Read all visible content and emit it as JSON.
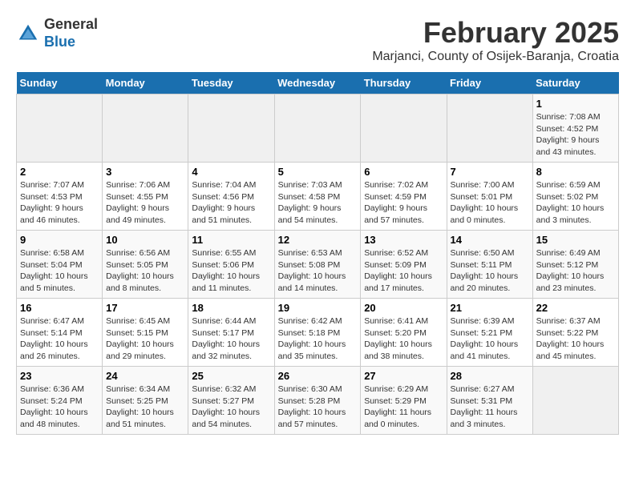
{
  "header": {
    "logo_general": "General",
    "logo_blue": "Blue",
    "month_title": "February 2025",
    "location": "Marjanci, County of Osijek-Baranja, Croatia"
  },
  "days_of_week": [
    "Sunday",
    "Monday",
    "Tuesday",
    "Wednesday",
    "Thursday",
    "Friday",
    "Saturday"
  ],
  "weeks": [
    [
      {
        "day": "",
        "info": ""
      },
      {
        "day": "",
        "info": ""
      },
      {
        "day": "",
        "info": ""
      },
      {
        "day": "",
        "info": ""
      },
      {
        "day": "",
        "info": ""
      },
      {
        "day": "",
        "info": ""
      },
      {
        "day": "1",
        "info": "Sunrise: 7:08 AM\nSunset: 4:52 PM\nDaylight: 9 hours\nand 43 minutes."
      }
    ],
    [
      {
        "day": "2",
        "info": "Sunrise: 7:07 AM\nSunset: 4:53 PM\nDaylight: 9 hours\nand 46 minutes."
      },
      {
        "day": "3",
        "info": "Sunrise: 7:06 AM\nSunset: 4:55 PM\nDaylight: 9 hours\nand 49 minutes."
      },
      {
        "day": "4",
        "info": "Sunrise: 7:04 AM\nSunset: 4:56 PM\nDaylight: 9 hours\nand 51 minutes."
      },
      {
        "day": "5",
        "info": "Sunrise: 7:03 AM\nSunset: 4:58 PM\nDaylight: 9 hours\nand 54 minutes."
      },
      {
        "day": "6",
        "info": "Sunrise: 7:02 AM\nSunset: 4:59 PM\nDaylight: 9 hours\nand 57 minutes."
      },
      {
        "day": "7",
        "info": "Sunrise: 7:00 AM\nSunset: 5:01 PM\nDaylight: 10 hours\nand 0 minutes."
      },
      {
        "day": "8",
        "info": "Sunrise: 6:59 AM\nSunset: 5:02 PM\nDaylight: 10 hours\nand 3 minutes."
      }
    ],
    [
      {
        "day": "9",
        "info": "Sunrise: 6:58 AM\nSunset: 5:04 PM\nDaylight: 10 hours\nand 5 minutes."
      },
      {
        "day": "10",
        "info": "Sunrise: 6:56 AM\nSunset: 5:05 PM\nDaylight: 10 hours\nand 8 minutes."
      },
      {
        "day": "11",
        "info": "Sunrise: 6:55 AM\nSunset: 5:06 PM\nDaylight: 10 hours\nand 11 minutes."
      },
      {
        "day": "12",
        "info": "Sunrise: 6:53 AM\nSunset: 5:08 PM\nDaylight: 10 hours\nand 14 minutes."
      },
      {
        "day": "13",
        "info": "Sunrise: 6:52 AM\nSunset: 5:09 PM\nDaylight: 10 hours\nand 17 minutes."
      },
      {
        "day": "14",
        "info": "Sunrise: 6:50 AM\nSunset: 5:11 PM\nDaylight: 10 hours\nand 20 minutes."
      },
      {
        "day": "15",
        "info": "Sunrise: 6:49 AM\nSunset: 5:12 PM\nDaylight: 10 hours\nand 23 minutes."
      }
    ],
    [
      {
        "day": "16",
        "info": "Sunrise: 6:47 AM\nSunset: 5:14 PM\nDaylight: 10 hours\nand 26 minutes."
      },
      {
        "day": "17",
        "info": "Sunrise: 6:45 AM\nSunset: 5:15 PM\nDaylight: 10 hours\nand 29 minutes."
      },
      {
        "day": "18",
        "info": "Sunrise: 6:44 AM\nSunset: 5:17 PM\nDaylight: 10 hours\nand 32 minutes."
      },
      {
        "day": "19",
        "info": "Sunrise: 6:42 AM\nSunset: 5:18 PM\nDaylight: 10 hours\nand 35 minutes."
      },
      {
        "day": "20",
        "info": "Sunrise: 6:41 AM\nSunset: 5:20 PM\nDaylight: 10 hours\nand 38 minutes."
      },
      {
        "day": "21",
        "info": "Sunrise: 6:39 AM\nSunset: 5:21 PM\nDaylight: 10 hours\nand 41 minutes."
      },
      {
        "day": "22",
        "info": "Sunrise: 6:37 AM\nSunset: 5:22 PM\nDaylight: 10 hours\nand 45 minutes."
      }
    ],
    [
      {
        "day": "23",
        "info": "Sunrise: 6:36 AM\nSunset: 5:24 PM\nDaylight: 10 hours\nand 48 minutes."
      },
      {
        "day": "24",
        "info": "Sunrise: 6:34 AM\nSunset: 5:25 PM\nDaylight: 10 hours\nand 51 minutes."
      },
      {
        "day": "25",
        "info": "Sunrise: 6:32 AM\nSunset: 5:27 PM\nDaylight: 10 hours\nand 54 minutes."
      },
      {
        "day": "26",
        "info": "Sunrise: 6:30 AM\nSunset: 5:28 PM\nDaylight: 10 hours\nand 57 minutes."
      },
      {
        "day": "27",
        "info": "Sunrise: 6:29 AM\nSunset: 5:29 PM\nDaylight: 11 hours\nand 0 minutes."
      },
      {
        "day": "28",
        "info": "Sunrise: 6:27 AM\nSunset: 5:31 PM\nDaylight: 11 hours\nand 3 minutes."
      },
      {
        "day": "",
        "info": ""
      }
    ]
  ]
}
